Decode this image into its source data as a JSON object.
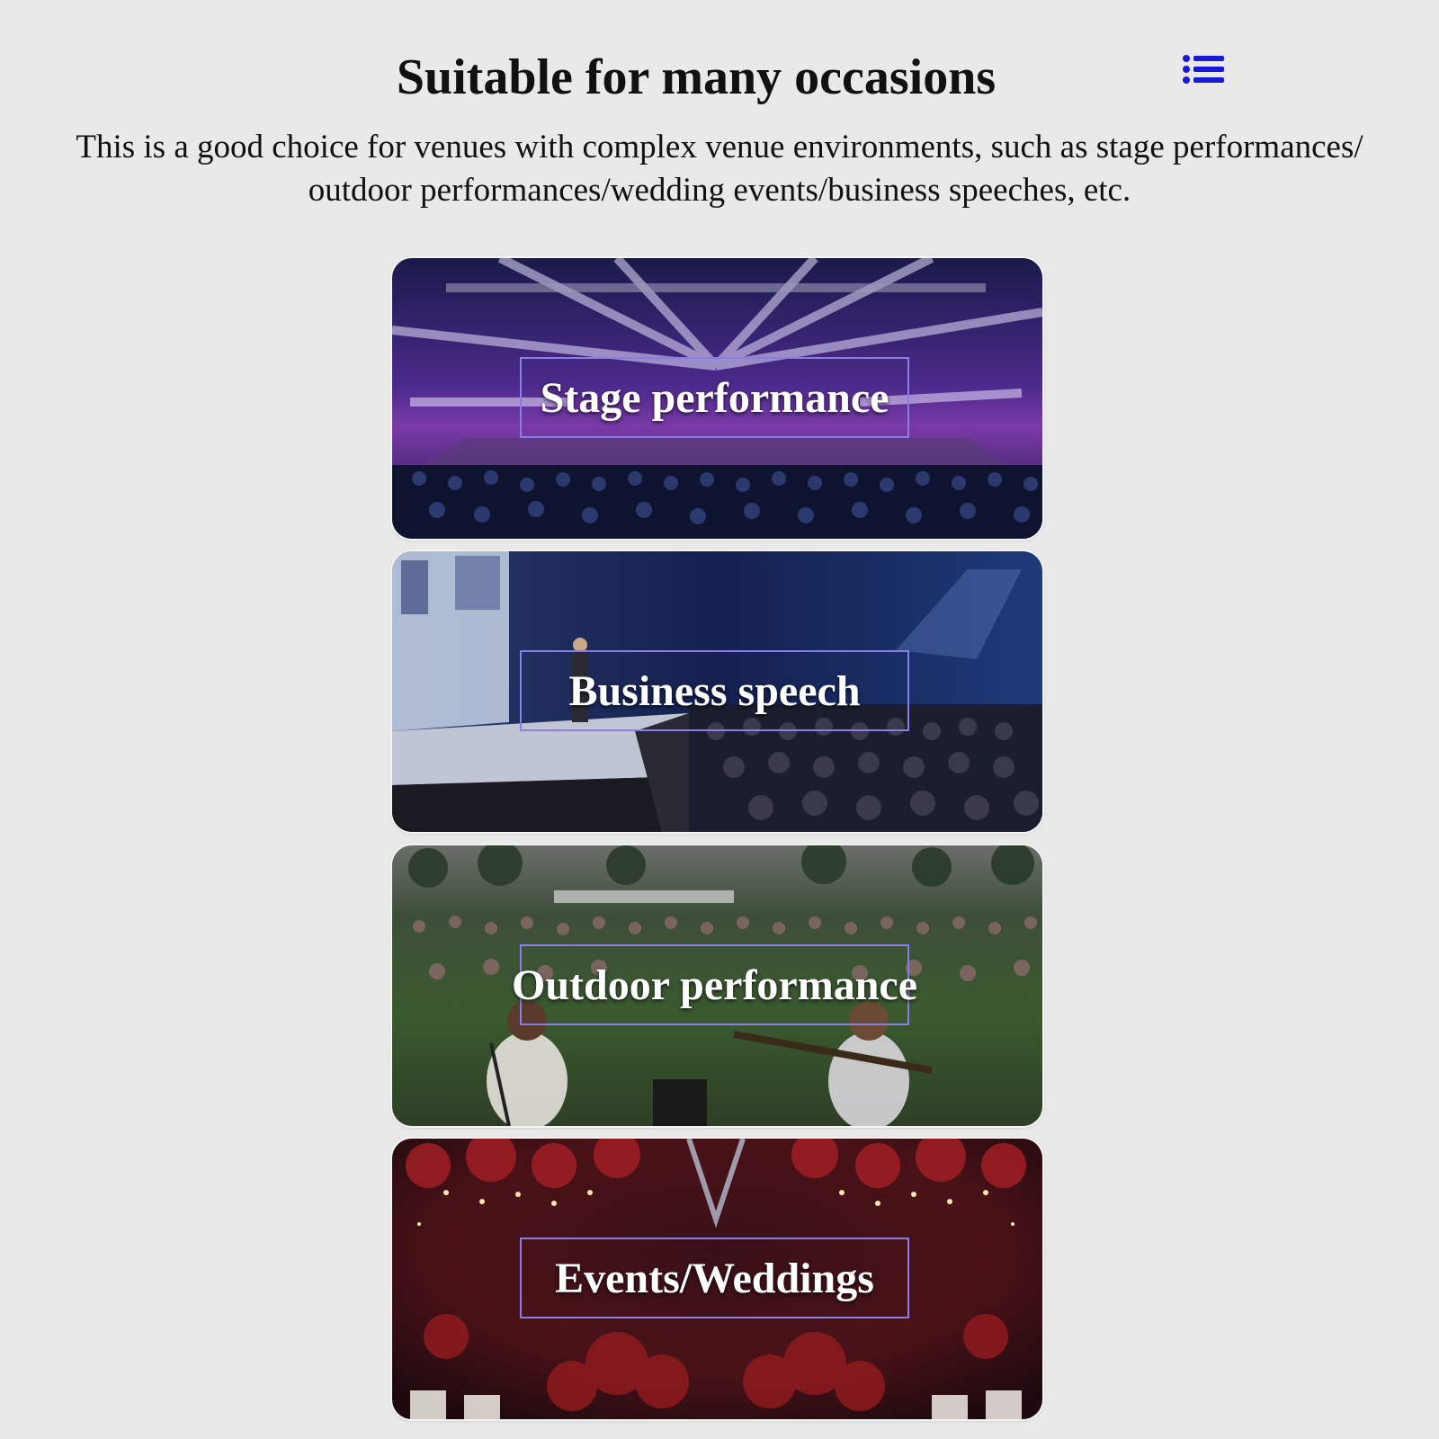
{
  "header": {
    "title": "Suitable for many occasions",
    "description": "This is a good choice for venues with complex venue environments, such as stage performances/ outdoor performances/wedding events/business speeches, etc.",
    "menu_icon": "list-icon",
    "accent_color": "#1a1ad6"
  },
  "occasions": [
    {
      "label": "Stage performance",
      "image": "concert-stage-photo"
    },
    {
      "label": "Business speech",
      "image": "conference-speech-photo"
    },
    {
      "label": "Outdoor performance",
      "image": "outdoor-lawn-concert-photo"
    },
    {
      "label": "Events/Weddings",
      "image": "wedding-hall-photo"
    }
  ],
  "colors": {
    "background": "#e9e9e9",
    "label_border": "#8a7ee6",
    "label_text": "#ffffff"
  }
}
